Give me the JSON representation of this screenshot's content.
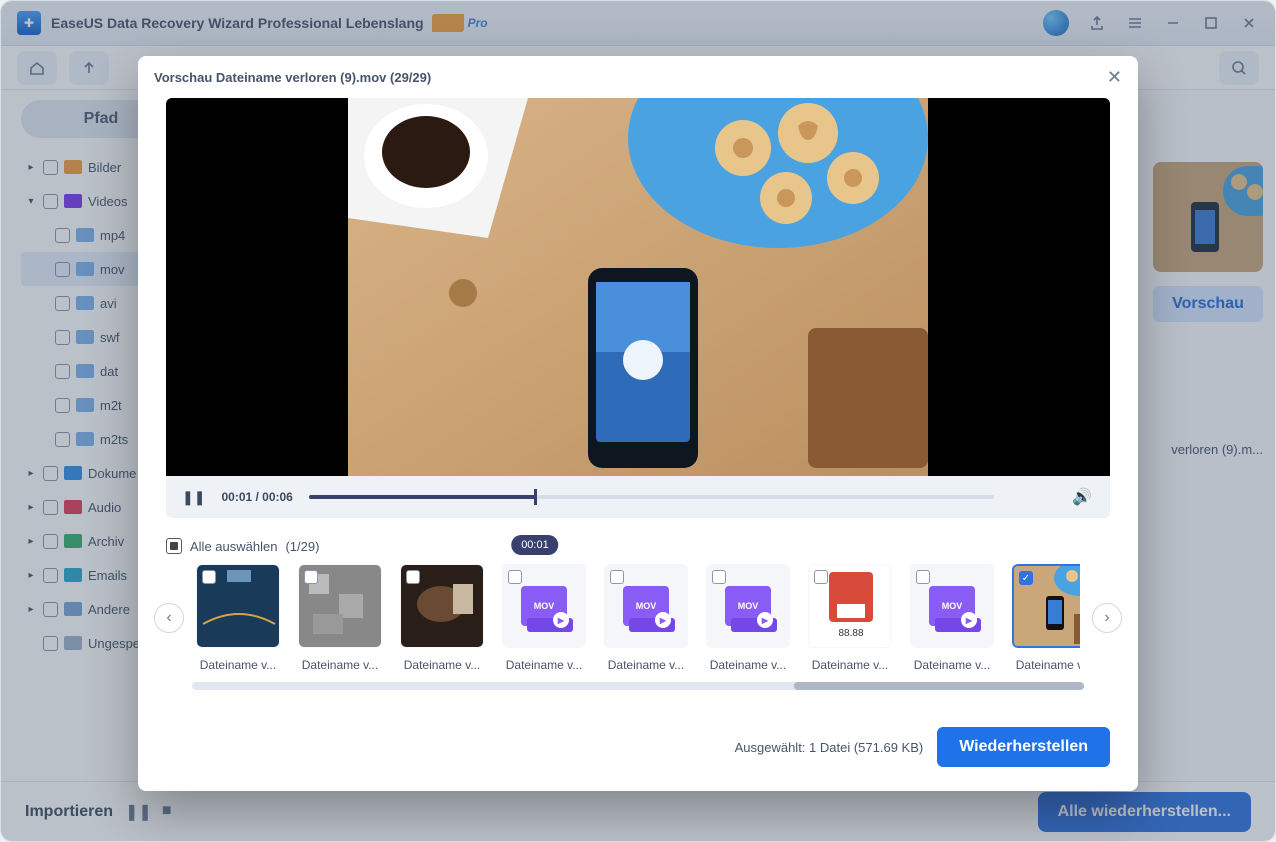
{
  "titlebar": {
    "app_name": "EaseUS Data Recovery Wizard Professional Lebenslang",
    "pro": "Pro"
  },
  "sidebar": {
    "tab": "Pfad",
    "categories": [
      {
        "label": "Bilder",
        "color": "#f59e42"
      },
      {
        "label": "Videos",
        "color": "#7c3aed",
        "expanded": true
      },
      {
        "label": "Dokumente",
        "color": "#2f8fe8",
        "truncated": "Dokume"
      },
      {
        "label": "Audio",
        "color": "#e23b57"
      },
      {
        "label": "Archiv",
        "color": "#35b06a"
      },
      {
        "label": "Emails",
        "color": "#2ba6c9"
      },
      {
        "label": "Andere",
        "color": "#7aa4d6"
      },
      {
        "label": "Ungespeichert",
        "color": "#9eb2c9",
        "truncated": "Ungespe"
      }
    ],
    "video_children": [
      "mp4",
      "mov",
      "avi",
      "swf",
      "dat",
      "m2t",
      "m2ts"
    ],
    "selected_child": "mov"
  },
  "content": {
    "preview_btn": "Vorschau",
    "file_label": "verloren (9).m..."
  },
  "footer": {
    "import": "Importieren",
    "restore_all": "Alle wiederherstellen..."
  },
  "modal": {
    "title": "Vorschau Dateiname verloren (9).mov (29/29)",
    "time": "00:01 / 00:06",
    "tooltip": "00:01",
    "progress_pct": 33,
    "select_all": "Alle auswählen",
    "select_count": "(1/29)",
    "thumbs": [
      {
        "type": "img",
        "label": "Dateiname v..."
      },
      {
        "type": "img",
        "label": "Dateiname v..."
      },
      {
        "type": "img",
        "label": "Dateiname v..."
      },
      {
        "type": "mov",
        "label": "Dateiname v..."
      },
      {
        "type": "mov",
        "label": "Dateiname v..."
      },
      {
        "type": "mov",
        "label": "Dateiname v..."
      },
      {
        "type": "img",
        "label": "Dateiname v..."
      },
      {
        "type": "mov",
        "label": "Dateiname v..."
      },
      {
        "type": "sel",
        "label": "Dateiname v..."
      }
    ],
    "selected_txt": "Ausgewählt: 1 Datei (571.69 KB)",
    "recover": "Wiederherstellen"
  }
}
